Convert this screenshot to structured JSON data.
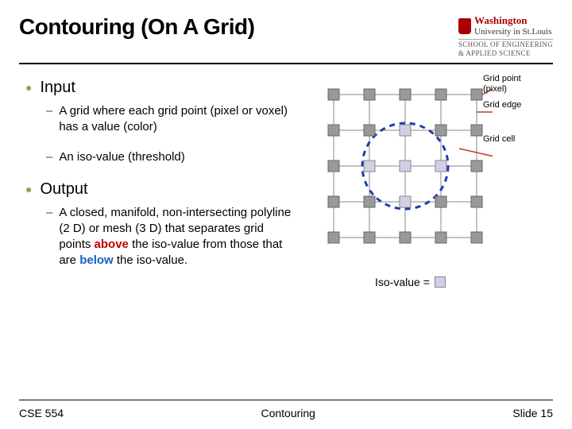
{
  "slide": {
    "title": "Contouring (On A Grid)"
  },
  "logo": {
    "univ_prefix": "Washington",
    "univ_suffix": "University in St.Louis",
    "school_l1": "SCHOOL OF ENGINEERING",
    "school_l2": "& APPLIED SCIENCE"
  },
  "body": {
    "input_label": "Input",
    "input_items": [
      "A grid where each grid point (pixel or voxel) has a value (color)",
      "An iso-value (threshold)"
    ],
    "output_label": "Output",
    "output_text_pre": "A closed, manifold, non-intersecting polyline (2 D) or mesh (3 D) that separates grid points ",
    "output_above": "above",
    "output_mid": " the iso-value from those that are ",
    "output_below": "below",
    "output_post": " the iso-value."
  },
  "diagram": {
    "grid_point": "Grid point (pixel)",
    "grid_edge": "Grid edge",
    "grid_cell": "Grid cell",
    "iso_label": "Iso-value ="
  },
  "footer": {
    "left": "CSE 554",
    "center": "Contouring",
    "right": "Slide 15"
  },
  "colors": {
    "grid_inside": "#d1cfe6",
    "grid_outside": "#999999",
    "iso_circle": "#1a3fb0",
    "arrow": "#c04020"
  }
}
